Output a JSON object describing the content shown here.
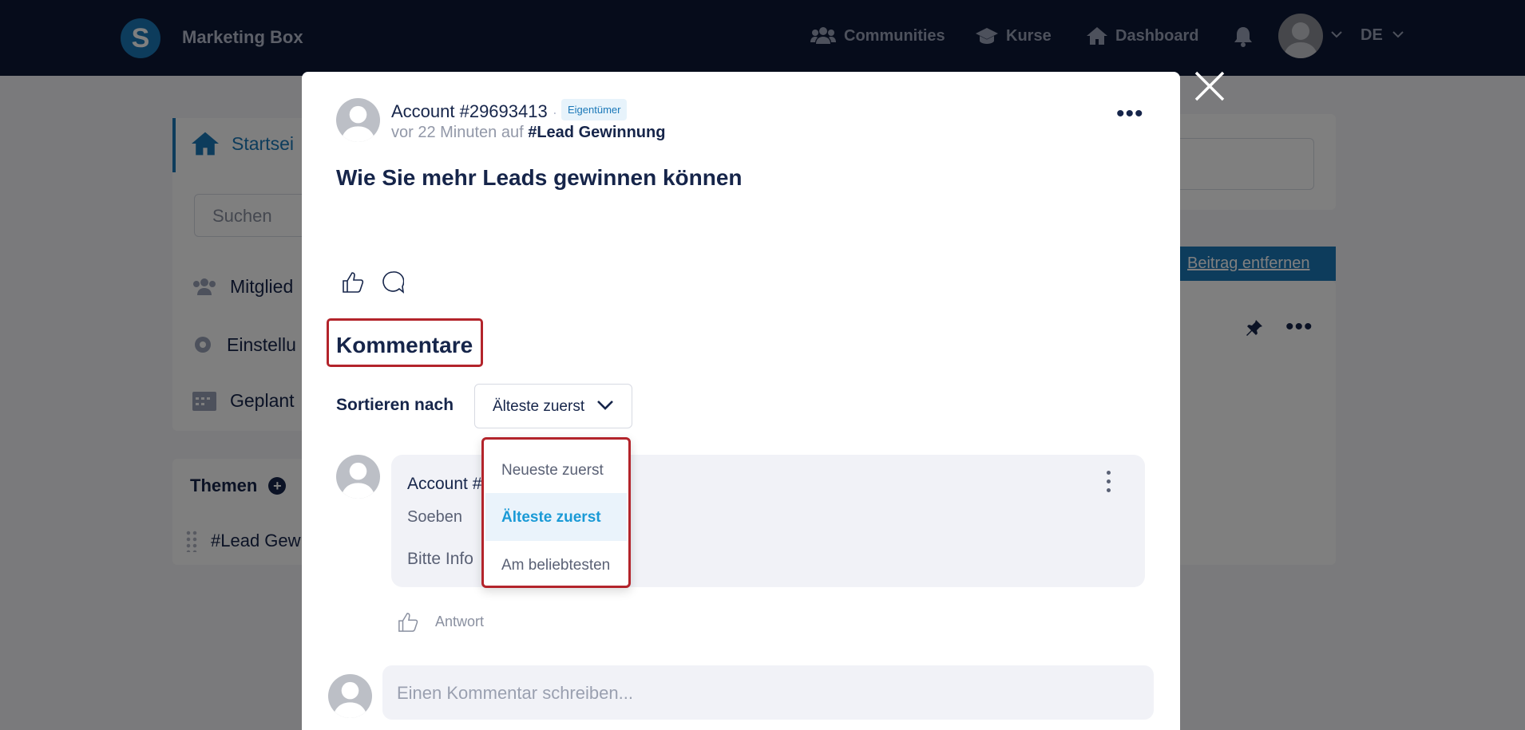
{
  "app": {
    "logo_letter": "S",
    "name": "Marketing Box"
  },
  "nav": {
    "communities": "Communities",
    "kurse": "Kurse",
    "dashboard": "Dashboard",
    "language": "DE"
  },
  "sidebar": {
    "home": "Startsei",
    "search_placeholder": "Suchen",
    "members": "Mitglied",
    "settings": "Einstellu",
    "scheduled": "Geplant",
    "topics_title": "Themen",
    "topic_item": "#Lead Gew"
  },
  "background": {
    "remove_post": "Beitrag entfernen"
  },
  "post": {
    "author": "Account #29693413",
    "separator": "·",
    "badge": "Eigentümer",
    "meta_prefix": "vor 22 Minuten auf ",
    "topic": "#Lead Gewinnung",
    "title": "Wie Sie mehr Leads gewinnen können"
  },
  "comments": {
    "heading": "Kommentare",
    "sort_label": "Sortieren nach",
    "sort_selected": "Älteste zuerst",
    "sort_options": [
      "Neueste zuerst",
      "Älteste zuerst",
      "Am beliebtesten"
    ],
    "comment": {
      "author": "Account #",
      "time": "Soeben",
      "text": "Bitte Info"
    },
    "reply_label": "Antwort",
    "input_placeholder": "Einen Kommentar schreiben..."
  },
  "colors": {
    "topbar": "#0d1836",
    "accent": "#1a78b8",
    "highlight_border": "#b3242b"
  }
}
